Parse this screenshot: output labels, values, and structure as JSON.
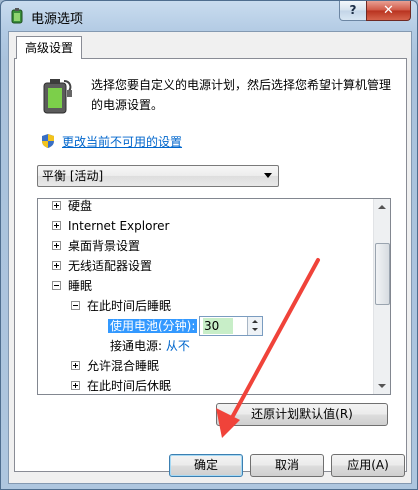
{
  "window": {
    "title": "电源选项",
    "title_icon": "battery-icon",
    "help_label": "?",
    "close_label": "✕"
  },
  "tab": {
    "label": "高级设置"
  },
  "description": "选择您要自定义的电源计划，然后选择您希望计算机管理的电源设置。",
  "change_link": "更改当前不可用的设置",
  "plan_select": {
    "value": "平衡 [活动]"
  },
  "tree": {
    "items": [
      {
        "label": "硬盘",
        "expanded": false
      },
      {
        "label": "Internet Explorer",
        "expanded": false
      },
      {
        "label": "桌面背景设置",
        "expanded": false
      },
      {
        "label": "无线适配器设置",
        "expanded": false
      },
      {
        "label": "睡眠",
        "expanded": true
      }
    ],
    "sleep_after": {
      "label": "在此时间后睡眠",
      "expanded": true
    },
    "on_battery": {
      "label": "使用电池(分钟):",
      "value": "30"
    },
    "plugged_in": {
      "label": "接通电源:",
      "value": "从不"
    },
    "hybrid_sleep": {
      "label": "允许混合睡眠",
      "expanded": false
    },
    "hibernate_after": {
      "label": "在此时间后休眠",
      "expanded": false
    }
  },
  "buttons": {
    "restore": "还原计划默认值(R)",
    "ok": "确定",
    "cancel": "取消",
    "apply": "应用(A)"
  },
  "colors": {
    "annotation_arrow": "#f0433a",
    "link": "#0066cc",
    "selection": "#3399ff"
  }
}
